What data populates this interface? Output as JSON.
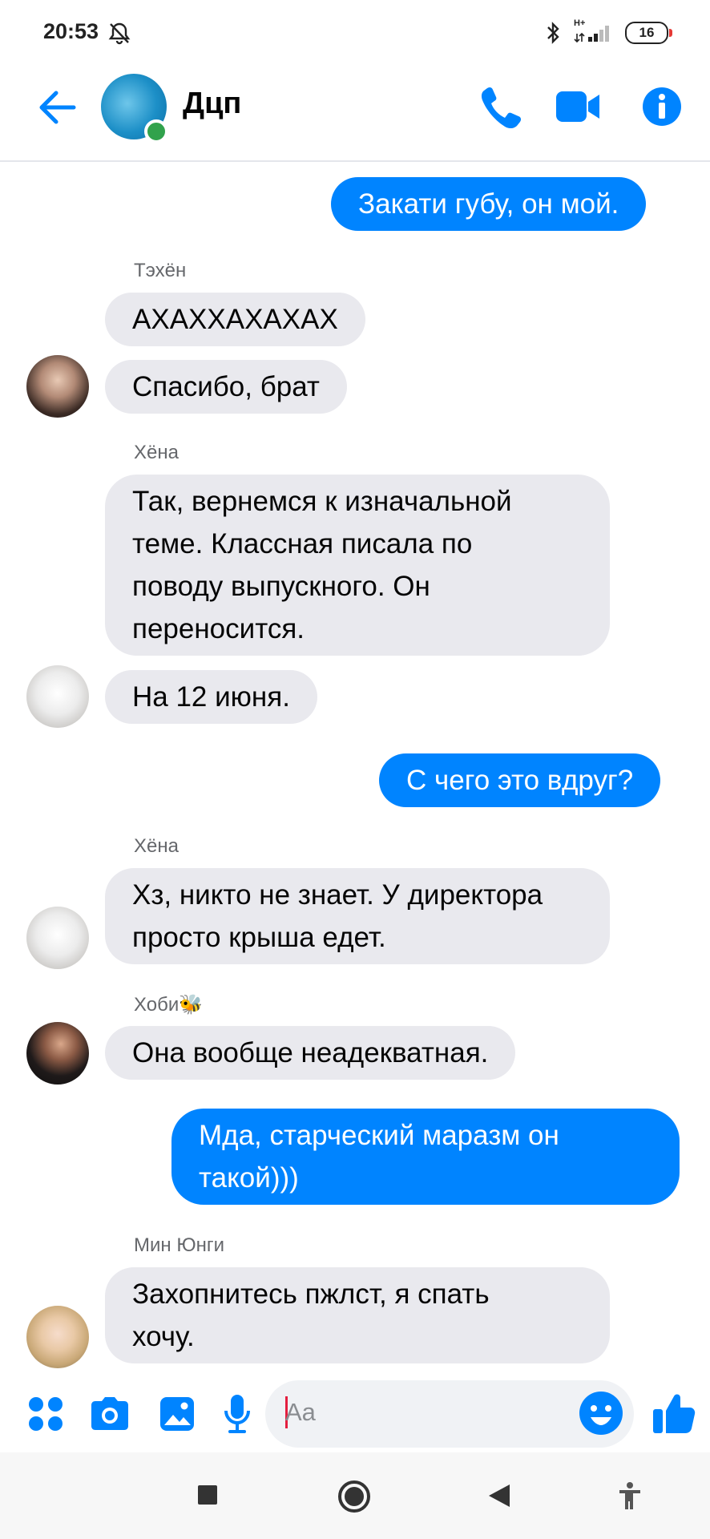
{
  "status_bar": {
    "time": "20:53",
    "battery": "16",
    "network_label": "H+",
    "icons": [
      "bell-off-icon",
      "bluetooth-icon",
      "signal-icon",
      "battery-icon"
    ]
  },
  "header": {
    "title": "Дцп",
    "icons": [
      "back-arrow-icon",
      "phone-icon",
      "video-camera-icon",
      "info-icon"
    ],
    "accent_color": "#0084ff",
    "online_color": "#31a24c"
  },
  "messages": [
    {
      "from": "me",
      "text": "Закати губу, он мой."
    },
    {
      "from": "Тэхён",
      "sender_label": "Тэхён",
      "text": "АХАХХАХАХАХ"
    },
    {
      "from": "Тэхён",
      "text": "Спасибо, брат"
    },
    {
      "from": "Хёна",
      "sender_label": "Хёна",
      "text": "Так, вернемся к изначальной\nтеме. Классная писала по\nповоду выпускного. Он\nпереносится."
    },
    {
      "from": "Хёна",
      "text": "На 12 июня."
    },
    {
      "from": "me",
      "text": "С чего это вдруг?"
    },
    {
      "from": "Хёна",
      "sender_label": "Хёна",
      "text": "Хз, никто не знает. У директора\nпросто крыша едет."
    },
    {
      "from": "Хоби",
      "sender_label": "Хоби",
      "sender_emoji": "🐝",
      "text": "Она вообще неадекватная."
    },
    {
      "from": "me",
      "text": "Мда, старческий маразм он\nтакой)))"
    },
    {
      "from": "Мин Юнги",
      "sender_label": "Мин Юнги",
      "text": "Захопнитесь пжлст, я спать\nхочу."
    }
  ],
  "composer": {
    "placeholder": "Aa",
    "icons": [
      "apps-icon",
      "camera-icon",
      "gallery-icon",
      "microphone-icon",
      "emoji-icon",
      "thumbs-up-icon"
    ]
  },
  "nav_bar": {
    "icons": [
      "recents-square-icon",
      "home-circle-icon",
      "back-triangle-icon",
      "accessibility-icon"
    ]
  }
}
